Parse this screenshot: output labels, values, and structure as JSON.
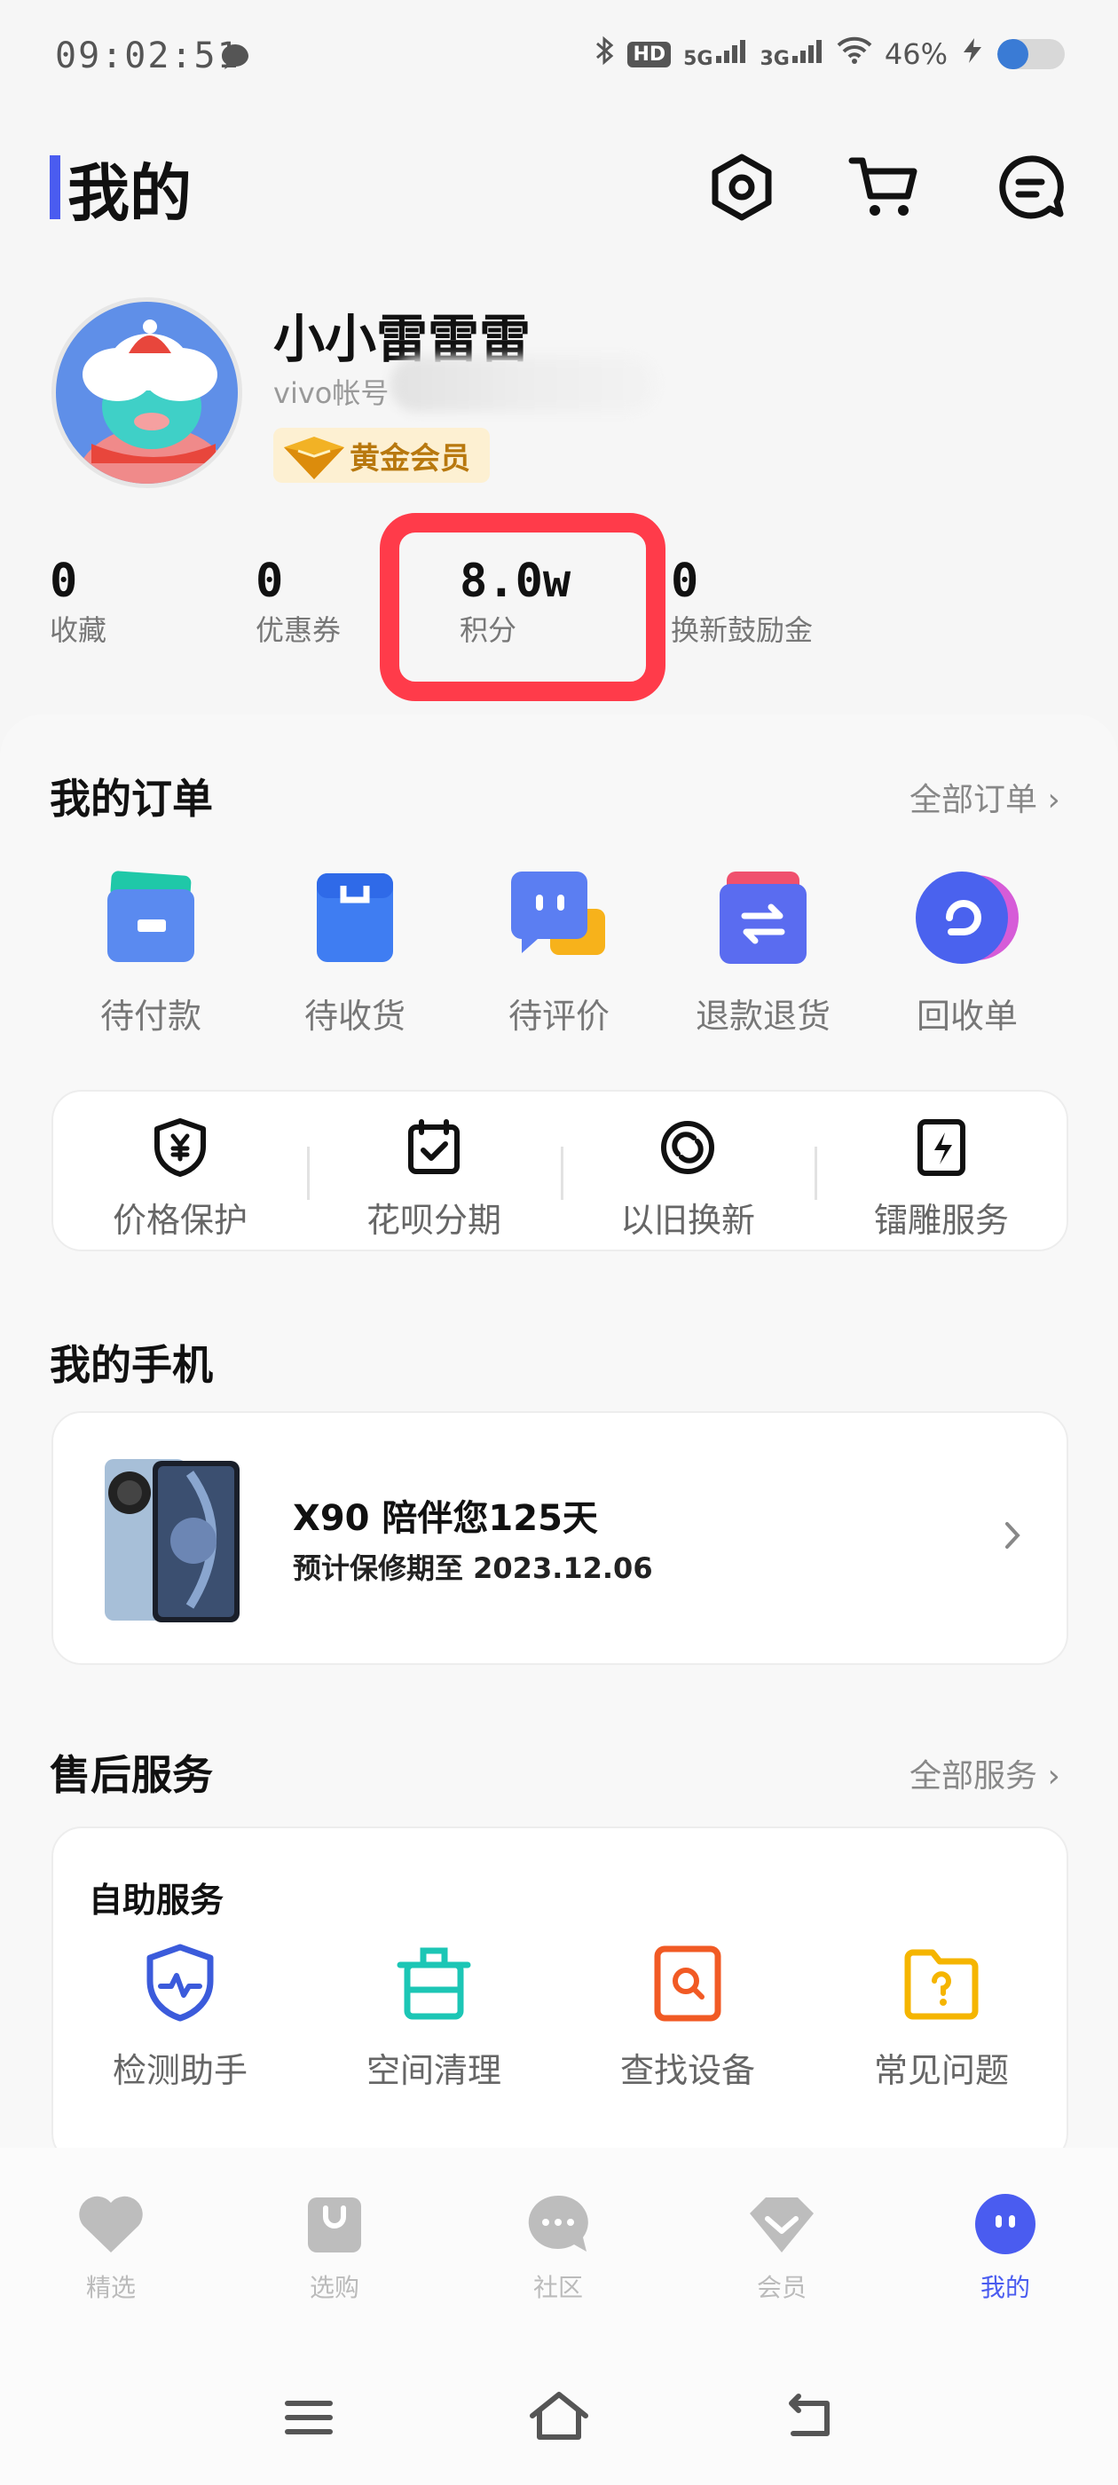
{
  "status_bar": {
    "time": "09:02:51",
    "network_hd": "HD",
    "network_5g": "5G",
    "network_3g": "3G",
    "battery_text": "46%",
    "battery_level": 0.46
  },
  "header": {
    "title": "我的",
    "icons": [
      "settings-icon",
      "cart-icon",
      "message-icon"
    ]
  },
  "profile": {
    "username": "小小雷雷雷",
    "account_prefix": "vivo帐号",
    "vip_label": "黄金会员"
  },
  "stats": [
    {
      "value": "0",
      "label": "收藏"
    },
    {
      "value": "0",
      "label": "优惠券"
    },
    {
      "value": "8.0w",
      "label": "积分"
    },
    {
      "value": "0",
      "label": "换新鼓励金"
    }
  ],
  "orders": {
    "title": "我的订单",
    "all_link": "全部订单",
    "items": [
      {
        "label": "待付款",
        "icon": "wallet-icon"
      },
      {
        "label": "待收货",
        "icon": "package-icon"
      },
      {
        "label": "待评价",
        "icon": "chat-review-icon"
      },
      {
        "label": "退款退货",
        "icon": "refund-icon"
      },
      {
        "label": "回收单",
        "icon": "recycle-icon"
      }
    ]
  },
  "services": [
    {
      "label": "价格保护",
      "icon": "yuan-shield-icon"
    },
    {
      "label": "花呗分期",
      "icon": "calendar-check-icon"
    },
    {
      "label": "以旧换新",
      "icon": "trade-in-icon"
    },
    {
      "label": "镭雕服务",
      "icon": "laser-engrave-icon"
    }
  ],
  "my_phone": {
    "title": "我的手机",
    "model_line": "X90 陪伴您125天",
    "warranty_line": "预计保修期至 2023.12.06"
  },
  "after_sales": {
    "title": "售后服务",
    "all_link": "全部服务",
    "subtitle": "自助服务",
    "tools": [
      {
        "label": "检测助手",
        "icon": "diagnose-shield-icon",
        "color": "#3b5bdb"
      },
      {
        "label": "空间清理",
        "icon": "clean-bin-icon",
        "color": "#1cc6b5"
      },
      {
        "label": "查找设备",
        "icon": "find-device-icon",
        "color": "#f15a24"
      },
      {
        "label": "常见问题",
        "icon": "faq-folder-icon",
        "color": "#f5b500"
      }
    ]
  },
  "tabbar": {
    "tabs": [
      {
        "label": "精选",
        "icon": "heart-icon"
      },
      {
        "label": "选购",
        "icon": "shopping-bag-icon"
      },
      {
        "label": "社区",
        "icon": "community-icon"
      },
      {
        "label": "会员",
        "icon": "member-icon"
      },
      {
        "label": "我的",
        "icon": "mine-icon",
        "active": true
      }
    ]
  },
  "colors": {
    "accent": "#4a5cf0",
    "highlight_box": "#ff3b4a",
    "vip_gold": "#b8780e"
  }
}
